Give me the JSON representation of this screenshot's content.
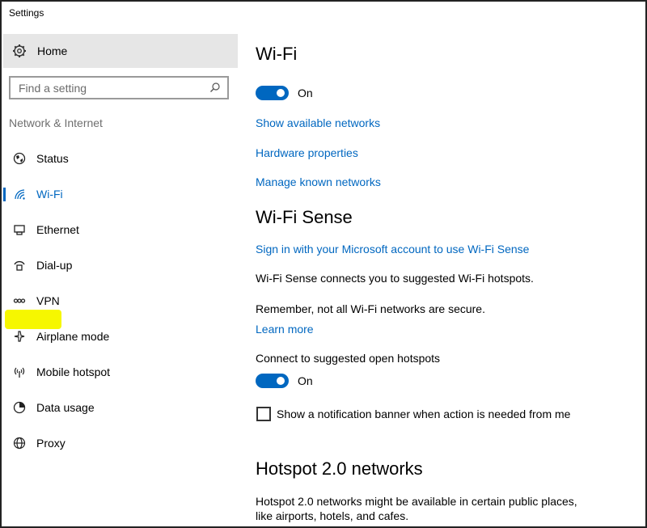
{
  "window": {
    "title": "Settings"
  },
  "sidebar": {
    "home_label": "Home",
    "search_placeholder": "Find a setting",
    "section_label": "Network & Internet",
    "items": [
      {
        "label": "Status",
        "icon": "status-globe-icon"
      },
      {
        "label": "Wi-Fi",
        "icon": "wifi-icon",
        "active": true
      },
      {
        "label": "Ethernet",
        "icon": "ethernet-icon"
      },
      {
        "label": "Dial-up",
        "icon": "dialup-icon"
      },
      {
        "label": "VPN",
        "icon": "vpn-icon",
        "highlighted": true
      },
      {
        "label": "Airplane mode",
        "icon": "airplane-icon"
      },
      {
        "label": "Mobile hotspot",
        "icon": "hotspot-icon"
      },
      {
        "label": "Data usage",
        "icon": "data-usage-icon"
      },
      {
        "label": "Proxy",
        "icon": "globe-icon"
      }
    ]
  },
  "main": {
    "wifi_title": "Wi-Fi",
    "wifi_toggle_label": "On",
    "links": {
      "show_networks": "Show available networks",
      "hardware_properties": "Hardware properties",
      "manage_networks": "Manage known networks"
    },
    "wifi_sense": {
      "title": "Wi-Fi Sense",
      "sign_in_link": "Sign in with your Microsoft account to use Wi-Fi Sense",
      "description": "Wi-Fi Sense connects you to suggested Wi-Fi hotspots.",
      "warning": "Remember, not all Wi-Fi networks are secure.",
      "learn_more": "Learn more",
      "connect_label": "Connect to suggested open hotspots",
      "connect_toggle_label": "On",
      "notification_checkbox_label": "Show a notification banner when action is needed from me"
    },
    "hotspot": {
      "title": "Hotspot 2.0 networks",
      "description_line1": "Hotspot 2.0 networks might be available in certain public places,",
      "description_line2": "like airports, hotels, and cafes."
    }
  },
  "colors": {
    "accent": "#0067c0",
    "highlight": "#f6f700",
    "home_bg": "#e6e6e6"
  }
}
